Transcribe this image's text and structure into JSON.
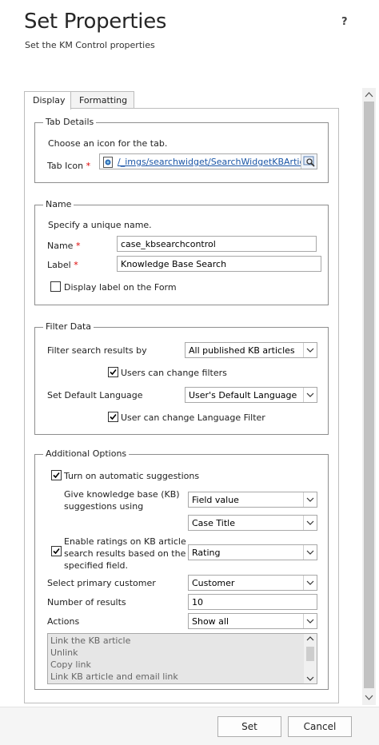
{
  "dialog": {
    "title": "Set Properties",
    "subtitle": "Set the KM Control properties",
    "help_glyph": "?"
  },
  "tabs": [
    {
      "label": "Display",
      "active": true
    },
    {
      "label": "Formatting",
      "active": false
    }
  ],
  "tab_details": {
    "legend": "Tab Details",
    "instruction": "Choose an icon for the tab.",
    "tab_icon_label": "Tab Icon",
    "required_marker": "*",
    "tab_icon_value": "/_imgs/searchwidget/SearchWidgetKBArticle"
  },
  "name_section": {
    "legend": "Name",
    "instruction": "Specify a unique name.",
    "name_label": "Name",
    "name_value": "case_kbsearchcontrol",
    "label_label": "Label",
    "label_value": "Knowledge Base Search",
    "display_label_checkbox": "Display label on the Form",
    "display_label_checked": false
  },
  "filter_data": {
    "legend": "Filter Data",
    "filter_label": "Filter search results by",
    "filter_value": "All published KB articles",
    "users_change_filters": "Users can change filters",
    "users_change_filters_checked": true,
    "default_language_label": "Set Default Language",
    "default_language_value": "User's Default Language",
    "user_change_language": "User can change Language Filter",
    "user_change_language_checked": true
  },
  "additional_options": {
    "legend": "Additional Options",
    "auto_suggestions": "Turn on automatic suggestions",
    "auto_suggestions_checked": true,
    "kb_suggestions_label_line1": "Give knowledge base (KB)",
    "kb_suggestions_label_line2": "suggestions using",
    "kb_suggestions_value": "Field value",
    "field_value": "Case Title",
    "ratings_label_line1": "Enable ratings on KB article",
    "ratings_label_line2": "search results based on the",
    "ratings_label_line3": "specified field.",
    "ratings_checked": true,
    "ratings_value": "Rating",
    "primary_customer_label": "Select primary customer",
    "primary_customer_value": "Customer",
    "num_results_label": "Number of results",
    "num_results_value": "10",
    "actions_label": "Actions",
    "actions_value": "Show all",
    "actions_list": [
      "Link the KB article",
      "Unlink",
      "Copy link",
      "Link KB article and email link"
    ]
  },
  "footer": {
    "set_label": "Set",
    "cancel_label": "Cancel"
  },
  "colors": {
    "required": "#dd0000",
    "link": "#1a55a6",
    "scrollbar_thumb": "#c2c2c2"
  }
}
